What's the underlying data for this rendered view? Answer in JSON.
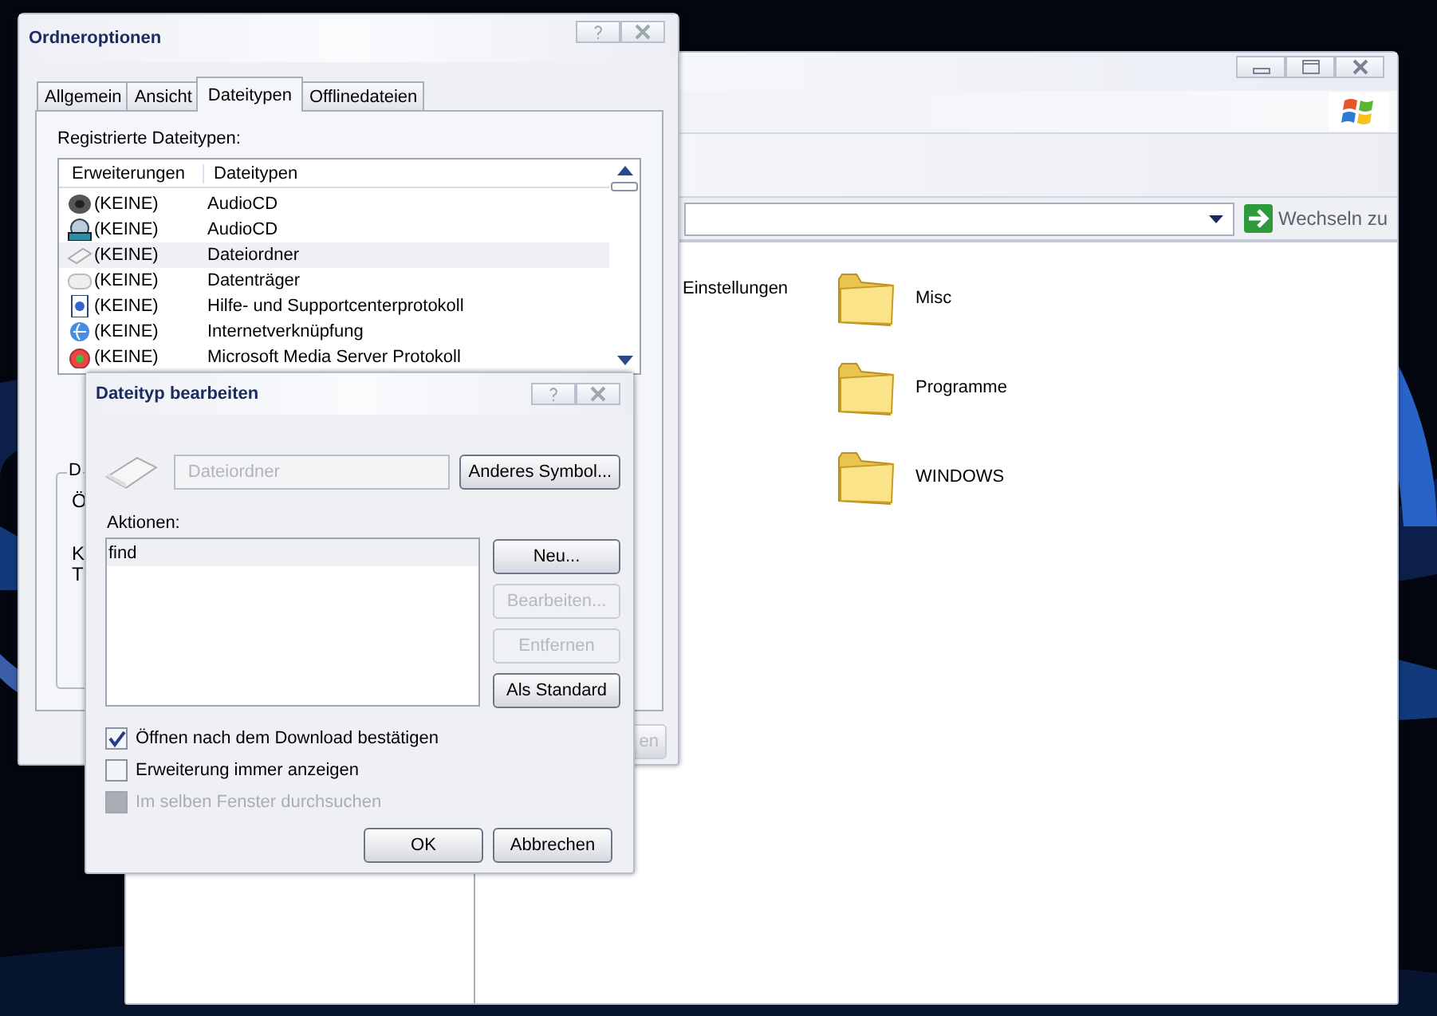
{
  "explorer_window": {
    "address_button": "Wechseln zu",
    "partial_item": "Einstellungen",
    "folders": [
      {
        "label": "Misc"
      },
      {
        "label": "Programme"
      },
      {
        "label": "WINDOWS"
      }
    ]
  },
  "folder_options": {
    "title": "Ordneroptionen",
    "tabs": [
      {
        "label": "Allgemein",
        "selected": false
      },
      {
        "label": "Ansicht",
        "selected": false
      },
      {
        "label": "Dateitypen",
        "selected": true
      },
      {
        "label": "Offlinedateien",
        "selected": false
      }
    ],
    "list_label": "Registrierte Dateitypen:",
    "columns": [
      "Erweiterungen",
      "Dateitypen"
    ],
    "rows": [
      {
        "extension": "(KEINE)",
        "type": "AudioCD",
        "selected": false
      },
      {
        "extension": "(KEINE)",
        "type": "AudioCD",
        "selected": false
      },
      {
        "extension": "(KEINE)",
        "type": "Dateiordner",
        "selected": true
      },
      {
        "extension": "(KEINE)",
        "type": "Datenträger",
        "selected": false
      },
      {
        "extension": "(KEINE)",
        "type": "Hilfe- und Supportcenterprotokoll",
        "selected": false
      },
      {
        "extension": "(KEINE)",
        "type": "Internetverknüpfung",
        "selected": false
      },
      {
        "extension": "(KEINE)",
        "type": "Microsoft Media Server Protokoll",
        "selected": false
      }
    ],
    "group_label": "D",
    "group_lines": [
      "Ö",
      "K",
      "T"
    ],
    "partial_button": "en"
  },
  "edit_dialog": {
    "title": "Dateityp bearbeiten",
    "type_field": "Dateiordner",
    "icon_button": "Anderes Symbol...",
    "actions_label": "Aktionen:",
    "actions": [
      {
        "label": "find",
        "selected": true
      }
    ],
    "action_buttons": [
      {
        "label": "Neu...",
        "disabled": false
      },
      {
        "label": "Bearbeiten...",
        "disabled": true
      },
      {
        "label": "Entfernen",
        "disabled": true
      },
      {
        "label": "Als Standard",
        "disabled": false
      }
    ],
    "options": [
      {
        "label": "Öffnen nach dem Download bestätigen",
        "checked": true,
        "disabled": false
      },
      {
        "label": "Erweiterung immer anzeigen",
        "checked": false,
        "disabled": false
      },
      {
        "label": "Im selben Fenster durchsuchen",
        "checked": false,
        "disabled": true
      }
    ],
    "buttons": [
      "OK",
      "Abbrechen"
    ]
  }
}
